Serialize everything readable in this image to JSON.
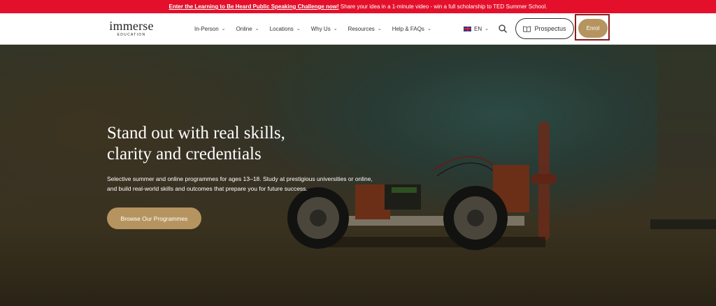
{
  "announcement": {
    "link_text": "Enter the Learning to Be Heard Public Speaking Challenge now!",
    "text": " Share your idea in a 1-minute video - win a full scholarship to TED Summer School."
  },
  "logo": {
    "name": "immerse",
    "sub": "EDUCATION"
  },
  "nav": {
    "items": [
      {
        "label": "In-Person"
      },
      {
        "label": "Online"
      },
      {
        "label": "Locations"
      },
      {
        "label": "Why Us"
      },
      {
        "label": "Resources"
      },
      {
        "label": "Help & FAQs"
      }
    ],
    "language": "EN",
    "prospectus_label": "Prospectus",
    "enrol_label": "Enrol"
  },
  "hero": {
    "headline": "Stand out with real skills, clarity and credentials",
    "subtext": "Selective summer and online programmes for ages 13–18. Study at prestigious universities or online, and build real-world skills and outcomes that prepare you for future success.",
    "cta_label": "Browse Our Programmes"
  },
  "colors": {
    "announcement_bg": "#e4102b",
    "accent_gold": "#b69460",
    "highlight_frame": "#8b1c1c"
  },
  "icons": [
    "chevron-down-icon",
    "uk-flag-icon",
    "search-icon",
    "book-icon"
  ]
}
